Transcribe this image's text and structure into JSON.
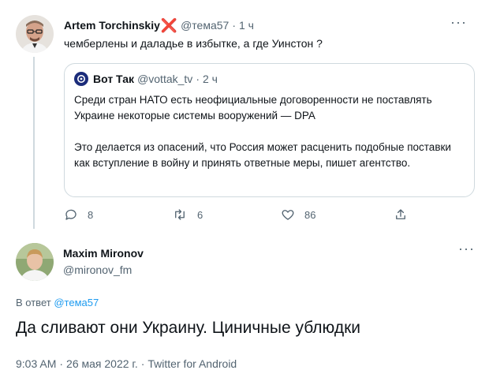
{
  "tweet1": {
    "author_name": "Artem Torchinskiy",
    "author_badge": "❌",
    "handle": "@тема57",
    "separator": "·",
    "time": "1 ч",
    "text": "чемберлены и даладье в избытке, а где Уинстон ?",
    "more_label": "···",
    "quoted": {
      "author_name": "Вот Так",
      "handle": "@vottak_tv",
      "separator": "·",
      "time": "2 ч",
      "paragraph1": "Среди стран НАТО есть неофициальные договоренности не поставлять Украине некоторые системы вооружений — DPA",
      "paragraph2": "Это делается из опасений, что Россия может расценить подобные поставки как вступление в войну и принять ответные меры, пишет агентство."
    },
    "actions": {
      "replies": "8",
      "retweets": "6",
      "likes": "86"
    }
  },
  "tweet2": {
    "author_name": "Maxim Mironov",
    "handle": "@mironov_fm",
    "more_label": "···",
    "reply_prefix": "В ответ",
    "reply_to_handle": "@тема57",
    "text": "Да сливают они Украину. Циничные ублюдки",
    "time": "9:03 AM",
    "date": "26 мая 2022 г.",
    "separator": "·",
    "source": "Twitter for Android"
  },
  "colors": {
    "text_primary": "#0f1419",
    "text_secondary": "#536471",
    "link": "#1d9bf0",
    "border": "#cfd9de",
    "badge_red": "#e0245e"
  },
  "icons": {
    "reply": "reply-icon",
    "retweet": "retweet-icon",
    "like": "heart-icon",
    "share": "share-icon",
    "more": "more-icon"
  }
}
